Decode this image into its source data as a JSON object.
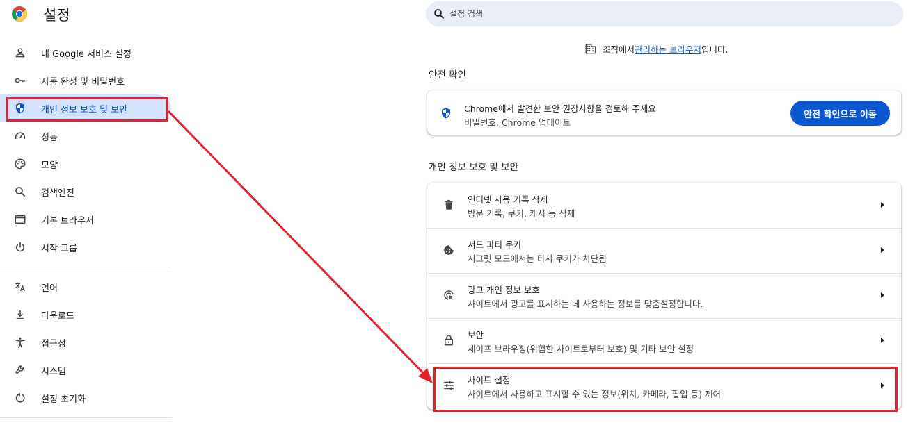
{
  "header": {
    "title": "설정",
    "search_placeholder": "설정 검색"
  },
  "sidebar": {
    "items": [
      {
        "label": "내 Google 서비스 설정",
        "icon": "person-icon"
      },
      {
        "label": "자동 완성 및 비밀번호",
        "icon": "key-icon"
      },
      {
        "label": "개인 정보 보호 및 보안",
        "icon": "shield-icon",
        "active": true
      },
      {
        "label": "성능",
        "icon": "speedometer-icon"
      },
      {
        "label": "모양",
        "icon": "palette-icon"
      },
      {
        "label": "검색엔진",
        "icon": "search-icon"
      },
      {
        "label": "기본 브라우저",
        "icon": "browser-window-icon"
      },
      {
        "label": "시작 그룹",
        "icon": "power-icon"
      },
      {
        "label": "언어",
        "icon": "translate-icon"
      },
      {
        "label": "다운로드",
        "icon": "download-icon"
      },
      {
        "label": "접근성",
        "icon": "accessibility-icon"
      },
      {
        "label": "시스템",
        "icon": "wrench-icon"
      },
      {
        "label": "설정 초기화",
        "icon": "reset-icon"
      }
    ]
  },
  "managed": {
    "prefix": "조직에서 ",
    "link": "관리하는 브라우저",
    "suffix": "입니다."
  },
  "safety_check": {
    "section_title": "안전 확인",
    "title": "Chrome에서 발견한 보안 권장사항을 검토해 주세요",
    "subtitle": "비밀번호, Chrome 업데이트",
    "button": "안전 확인으로 이동"
  },
  "privacy": {
    "section_title": "개인 정보 보호 및 보안",
    "rows": [
      {
        "title": "인터넷 사용 기록 삭제",
        "subtitle": "방문 기록, 쿠키, 캐시 등 삭제",
        "icon": "trash-icon"
      },
      {
        "title": "서드 파티 쿠키",
        "subtitle": "시크릿 모드에서는 타사 쿠키가 차단됨",
        "icon": "cookie-icon"
      },
      {
        "title": "광고 개인 정보 보호",
        "subtitle": "사이트에서 광고를 표시하는 데 사용하는 정보를 맞춤설정합니다.",
        "icon": "ad-privacy-icon"
      },
      {
        "title": "보안",
        "subtitle": "세이프 브라우징(위험한 사이트로부터 보호) 및 기타 보안 설정",
        "icon": "lock-icon"
      },
      {
        "title": "사이트 설정",
        "subtitle": "사이트에서 사용하고 표시할 수 있는 정보(위치, 카메라, 팝업 등) 제어",
        "icon": "sliders-icon"
      }
    ]
  },
  "colors": {
    "accent": "#0b57d0",
    "active_bg": "#d3e3fd",
    "annotation": "#e3232b"
  }
}
